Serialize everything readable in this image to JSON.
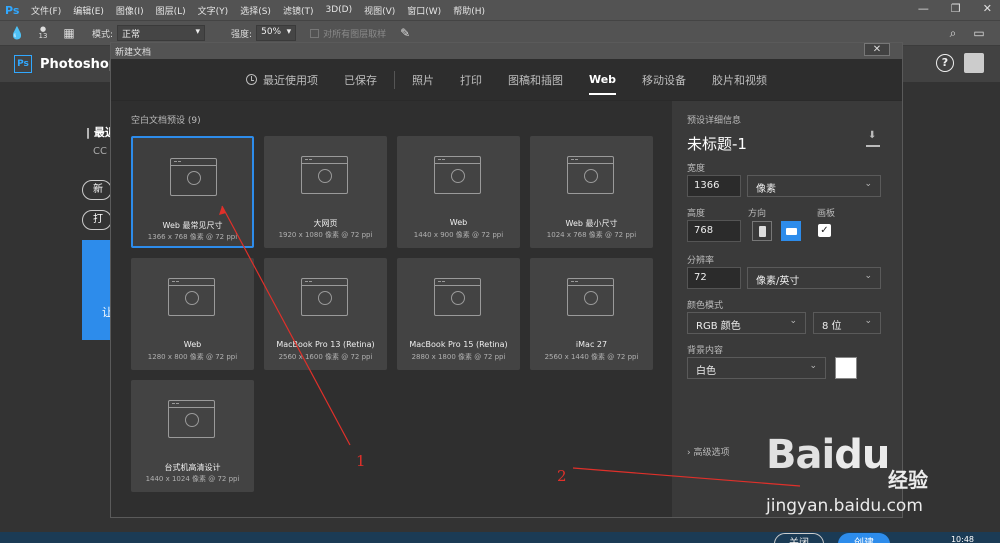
{
  "menubar": {
    "logo": "Ps",
    "items": [
      "文件(F)",
      "编辑(E)",
      "图像(I)",
      "图层(L)",
      "文字(Y)",
      "选择(S)",
      "滤镜(T)",
      "3D(D)",
      "视图(V)",
      "窗口(W)",
      "帮助(H)"
    ],
    "win_controls": [
      "—",
      "❐",
      "✕"
    ]
  },
  "optbar": {
    "brush_size": "13",
    "mode_label": "模式:",
    "mode_value": "正常",
    "strength_label": "强度:",
    "strength_value": "50%",
    "sample_all": "对所有图层取样"
  },
  "start": {
    "app_name": "Photoshop",
    "app_badge": "Ps",
    "help": "?",
    "recent": "| 最近",
    "cc": "CC",
    "btn_new": "新建",
    "btn_open": "打开",
    "blue_text": "让"
  },
  "dialog": {
    "title": "新建文档",
    "close": "✕",
    "tabs": [
      "最近使用项",
      "已保存",
      "照片",
      "打印",
      "图稿和插图",
      "Web",
      "移动设备",
      "胶片和视频"
    ],
    "active_tab": "Web",
    "presets_header": "空白文档预设 (9)",
    "presets": [
      {
        "name": "Web 最常见尺寸",
        "spec": "1366 x 768 像素 @ 72 ppi",
        "selected": true
      },
      {
        "name": "大网页",
        "spec": "1920 x 1080 像素 @ 72 ppi"
      },
      {
        "name": "Web",
        "spec": "1440 x 900 像素 @ 72 ppi"
      },
      {
        "name": "Web 最小尺寸",
        "spec": "1024 x 768 像素 @ 72 ppi"
      },
      {
        "name": "Web",
        "spec": "1280 x 800 像素 @ 72 ppi"
      },
      {
        "name": "MacBook Pro 13 (Retina)",
        "spec": "2560 x 1600 像素 @ 72 ppi"
      },
      {
        "name": "MacBook Pro 15 (Retina)",
        "spec": "2880 x 1800 像素 @ 72 ppi"
      },
      {
        "name": "iMac 27",
        "spec": "2560 x 1440 像素 @ 72 ppi"
      },
      {
        "name": "台式机高清设计",
        "spec": "1440 x 1024 像素 @ 72 ppi"
      }
    ],
    "details": {
      "header": "预设详细信息",
      "doc_name": "未标题-1",
      "width_label": "宽度",
      "width_value": "1366",
      "width_unit": "像素",
      "height_label": "高度",
      "height_value": "768",
      "orientation_label": "方向",
      "artboard_label": "画板",
      "resolution_label": "分辨率",
      "resolution_value": "72",
      "resolution_unit": "像素/英寸",
      "color_mode_label": "颜色模式",
      "color_mode_value": "RGB 颜色",
      "bit_depth": "8 位",
      "background_label": "背景内容",
      "background_value": "白色",
      "advanced": "高级选项",
      "btn_close": "关闭",
      "btn_create": "创建"
    }
  },
  "annotations": {
    "label_1": "1",
    "label_2": "2",
    "color": "#e0302a"
  },
  "watermark": {
    "logo": "Bai",
    "logo_paw": "du",
    "cn": "经验",
    "url": "jingyan.baidu.com"
  },
  "taskbar": {
    "clock": "10:48"
  }
}
